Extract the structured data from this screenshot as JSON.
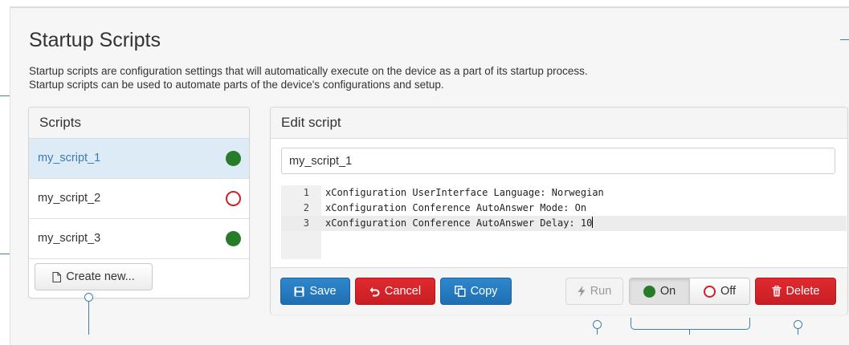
{
  "page": {
    "title": "Startup Scripts",
    "description_line1": "Startup scripts are configuration settings that will automatically execute on the device as a part of its startup process.",
    "description_line2": "Startup scripts can be used to automate parts of the device's configurations and setup."
  },
  "scripts_panel": {
    "heading": "Scripts",
    "items": [
      {
        "name": "my_script_1",
        "enabled": true,
        "selected": true
      },
      {
        "name": "my_script_2",
        "enabled": false,
        "selected": false
      },
      {
        "name": "my_script_3",
        "enabled": true,
        "selected": false
      }
    ],
    "create_label": "Create new..."
  },
  "editor": {
    "heading": "Edit script",
    "script_name_value": "my_script_1",
    "lines": [
      {
        "num": "1",
        "text": "xConfiguration UserInterface Language: Norwegian"
      },
      {
        "num": "2",
        "text": "xConfiguration Conference AutoAnswer Mode: On"
      },
      {
        "num": "3",
        "text": "xConfiguration Conference AutoAnswer Delay: 10"
      }
    ],
    "current_line": 3
  },
  "toolbar": {
    "save_label": "Save",
    "cancel_label": "Cancel",
    "copy_label": "Copy",
    "run_label": "Run",
    "on_label": "On",
    "off_label": "Off",
    "delete_label": "Delete"
  },
  "colors": {
    "enabled_green": "#267c28",
    "disabled_red": "#d01f25",
    "primary_blue": "#1f6fb2",
    "danger_red": "#c91e24",
    "selected_row": "#dcebf5",
    "leader_line": "#3f7ea6"
  },
  "icons": {
    "create": "document-icon",
    "save": "floppy-disk-icon",
    "cancel": "undo-arrow-icon",
    "copy": "copy-icon",
    "run": "lightning-bolt-icon",
    "delete": "trash-icon",
    "enabled": "green-dot-icon",
    "disabled": "red-ring-icon"
  }
}
